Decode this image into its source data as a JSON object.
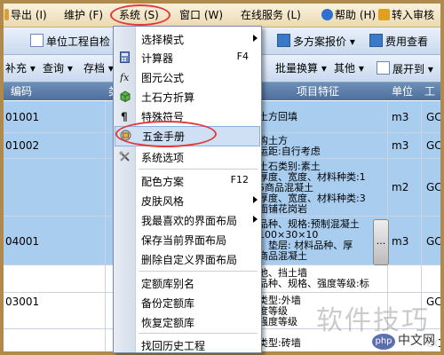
{
  "menubar": {
    "items": [
      {
        "label": "导出 (I)"
      },
      {
        "label": "维护 (F)"
      },
      {
        "label": "系统 (S)"
      },
      {
        "label": "窗口 (W)"
      },
      {
        "label": "在线服务 (L)"
      },
      {
        "label": "帮助 (H)"
      },
      {
        "label": "转入审核"
      }
    ]
  },
  "toolbar1": {
    "items": [
      {
        "label": "单位工程自检"
      },
      {
        "label": "多方案报价"
      },
      {
        "label": "费用查看"
      }
    ]
  },
  "toolbar2": {
    "items": [
      {
        "label": "补充"
      },
      {
        "label": "查询"
      },
      {
        "label": "存档"
      },
      {
        "label": "批量换算"
      },
      {
        "label": "其他"
      },
      {
        "label": "展开到"
      }
    ]
  },
  "table": {
    "headers": [
      "编码",
      "类",
      "项目特征",
      "单位",
      "工"
    ],
    "rows": [
      {
        "code": "01001",
        "unit": "m3",
        "extra": "GC",
        "features": [
          "土方回填"
        ]
      },
      {
        "code": "01002",
        "unit": "m3",
        "extra": "GC",
        "features": [
          "购土方",
          "运距:自行考虑"
        ]
      },
      {
        "code": "",
        "unit": "m2",
        "extra": "GC",
        "features": [
          "土石类别:素土",
          "厚度、宽度、材料种类:1",
          "5商品混凝土",
          "厚度、宽度、材料种类:3",
          "面铺花岗岩"
        ]
      },
      {
        "code": "04001",
        "unit": "m3",
        "extra": "GC",
        "features": [
          "品种、规格:预制混凝土",
          "100×30×10",
          "、垫层: 材料品种、厚",
          "商品混凝土"
        ]
      },
      {
        "code": "",
        "unit": "",
        "extra": "",
        "features": [
          "池、挡土墙",
          "品种、规格、强度等级:标"
        ]
      },
      {
        "code": "03001",
        "unit": "",
        "extra": "GC",
        "features": [
          "类型:外墙",
          "度等级",
          "强度等级"
        ]
      },
      {
        "code": "",
        "unit": "",
        "extra": "GC",
        "features": [
          "类型:砖墙"
        ]
      }
    ]
  },
  "menu": {
    "items": [
      {
        "label": "选择模式",
        "shortcut": "",
        "icon": "none",
        "submenu": true
      },
      {
        "label": "计算器",
        "shortcut": "F4",
        "icon": "calculator-icon",
        "submenu": false
      },
      {
        "label": "图元公式",
        "shortcut": "",
        "icon": "formula-icon",
        "submenu": false
      },
      {
        "label": "土石方折算",
        "shortcut": "",
        "icon": "cube-icon",
        "submenu": false
      },
      {
        "label": "特殊符号",
        "shortcut": "",
        "icon": "pilcrow-icon",
        "submenu": false
      },
      {
        "label": "五金手册",
        "shortcut": "",
        "icon": "handbook-icon",
        "submenu": false
      },
      {
        "label": "系统选项",
        "shortcut": "",
        "icon": "tools-icon",
        "submenu": false
      },
      {
        "label": "配色方案",
        "shortcut": "F12",
        "icon": "none",
        "submenu": false
      },
      {
        "label": "皮肤风格",
        "shortcut": "",
        "icon": "none",
        "submenu": true
      },
      {
        "label": "我最喜欢的界面布局",
        "shortcut": "",
        "icon": "none",
        "submenu": true
      },
      {
        "label": "保存当前界面布局",
        "shortcut": "",
        "icon": "none",
        "submenu": false
      },
      {
        "label": "删除自定义界面布局",
        "shortcut": "",
        "icon": "none",
        "submenu": false
      },
      {
        "label": "定额库别名",
        "shortcut": "",
        "icon": "none",
        "submenu": false
      },
      {
        "label": "备份定额库",
        "shortcut": "",
        "icon": "none",
        "submenu": false
      },
      {
        "label": "恢复定额库",
        "shortcut": "",
        "icon": "none",
        "submenu": false
      },
      {
        "label": "找回历史工程",
        "shortcut": "",
        "icon": "none",
        "submenu": false
      }
    ]
  },
  "scroll": {
    "label": "..."
  },
  "watermark": {
    "text": "软件技巧",
    "site": "中文网",
    "logo": "php"
  },
  "colors": {
    "highlight": "#e23a3a",
    "selected_row": "#a9cdef",
    "header": "#4d6f9c"
  }
}
